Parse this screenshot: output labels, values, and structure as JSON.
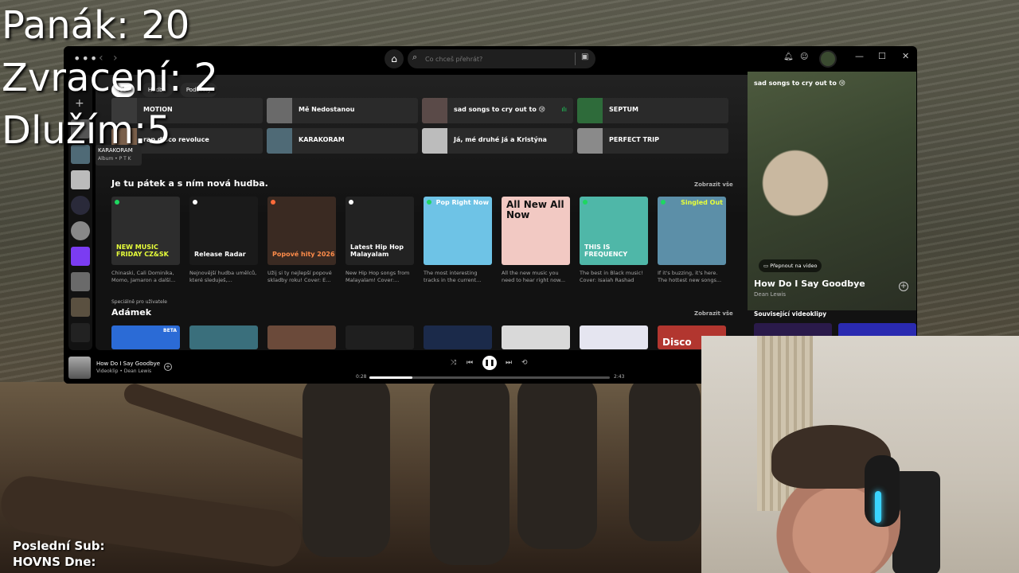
{
  "overlay": {
    "stat1": "Panák: 20",
    "stat2": "Zvracení: 2",
    "stat3": "Dlužím:5",
    "last_sub": "Poslední Sub:",
    "hovns": "HOVNS Dne:"
  },
  "topbar": {
    "menu_icon": "more-dots-icon",
    "search_placeholder": "Co chceš přehrát?",
    "icons": [
      "home-icon",
      "search-icon",
      "browse-icon",
      "bell-icon",
      "friends-icon",
      "minimize-icon",
      "maximize-icon",
      "close-icon"
    ]
  },
  "filters": [
    "Vše",
    "Hudba",
    "Podcasty"
  ],
  "quick_access": [
    {
      "label": "MOTION",
      "color": "#3a3a3a"
    },
    {
      "label": "Mě Nedostanou",
      "color": "#6a6a6a"
    },
    {
      "label": "sad songs to cry out to 😢",
      "color": "#5a4a48"
    },
    {
      "label": "SEPTUM",
      "color": "#2e6b3a"
    },
    {
      "label": "rap disco revoluce",
      "color": "#7a5f4a"
    },
    {
      "label": "KARAKORAM",
      "color": "#4f6a76"
    },
    {
      "label": "Já, mé druhé já a Kristýna",
      "color": "#bcbcbc"
    },
    {
      "label": "PERFECT TRIP",
      "color": "#8a8a8a"
    }
  ],
  "tooltip": {
    "title": "KARAKORAM",
    "subtitle": "Album • P T K"
  },
  "section1": {
    "title": "Je tu pátek a s ním nová hudba.",
    "show_all": "Zobrazit vše",
    "cards": [
      {
        "cover_text": "NEW MUSIC FRIDAY CZ&SK",
        "desc": "Chinaski, Cali Dominika, Momo, Jamaron a další...",
        "color": "#2d2d2d"
      },
      {
        "cover_text": "Release Radar",
        "desc": "Nejnovější hudba umělců, které sleduješ,...",
        "color": "#1a1a1a"
      },
      {
        "cover_text": "Popové hity 2026",
        "desc": "Užij si ty nejlepší popové skladby roku! Cover: E...",
        "color": "#3a2a22"
      },
      {
        "cover_text": "Latest Hip Hop Malayalam",
        "desc": "New Hip Hop songs from Malayalam! Cover:...",
        "color": "#222222"
      },
      {
        "cover_text": "Pop Right Now",
        "desc": "The most interesting tracks in the current...",
        "color": "#6ec3e6"
      },
      {
        "cover_text": "All New All Now",
        "desc": "All the new music you need to hear right now...",
        "color": "#f2c9c3"
      },
      {
        "cover_text": "THIS IS FREQUENCY",
        "desc": "The best in Black music! Cover: Isaiah Rashad",
        "color": "#4fb7a8"
      },
      {
        "cover_text": "Singled Out",
        "desc": "If it's buzzing, it's here. The hottest new songs...",
        "color": "#5c8fa8"
      }
    ]
  },
  "section2": {
    "subtitle": "Speciálně pro uživatele",
    "title": "Adámek",
    "show_all": "Zobrazit vše",
    "card_colors": [
      "#2b6bd6",
      "#3a6f7c",
      "#6b4a3a",
      "#1f1f1f",
      "#1b2a4a",
      "#d9d9d9",
      "#e5e5f0",
      "#b2362f"
    ],
    "card_texts": [
      "BETA",
      "",
      "",
      "",
      "",
      "",
      "",
      "Disco"
    ]
  },
  "now_playing_panel": {
    "header": "sad songs to cry out to 😢",
    "switch_label": "Přepnout na video",
    "song": "How Do I Say Goodbye",
    "artist": "Dean Lewis",
    "related": "Související videoklipy"
  },
  "player": {
    "title": "How Do I Say Goodbye",
    "subtitle": "Videoklip • Dean Lewis",
    "time_current": "0:28",
    "time_total": "2:43",
    "progress": 0.18
  }
}
